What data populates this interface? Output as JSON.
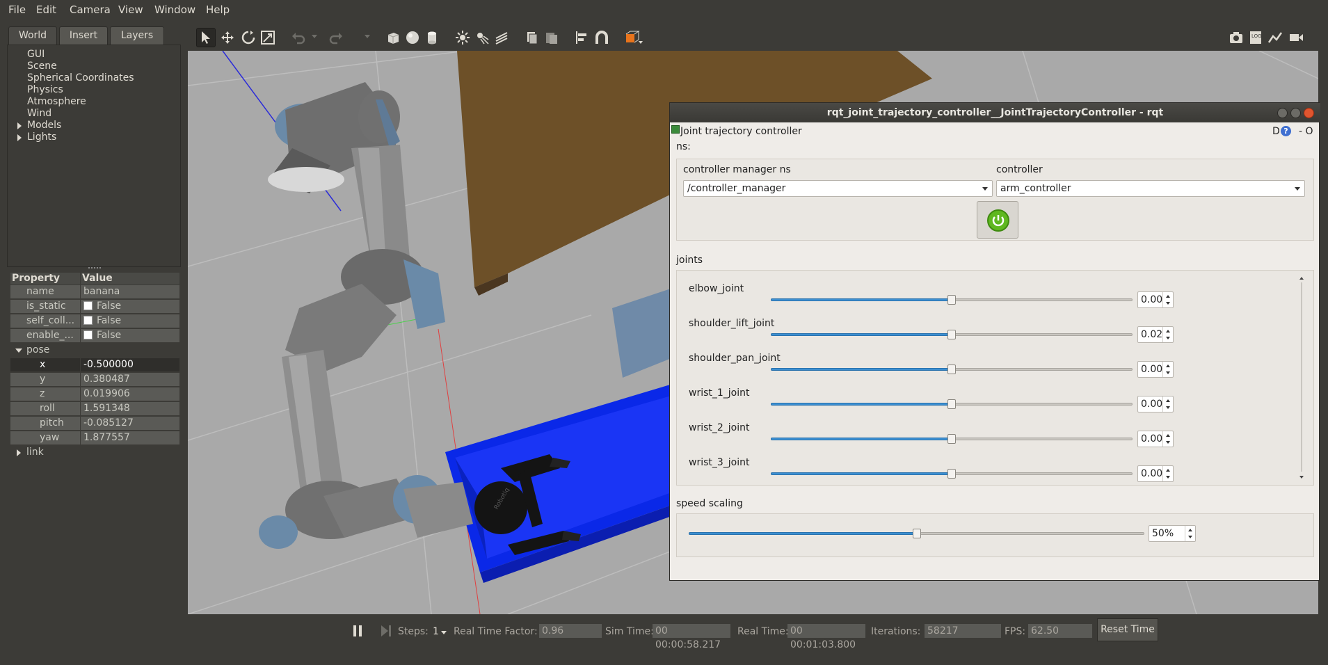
{
  "menubar": {
    "items": [
      "File",
      "Edit",
      "Camera",
      "View",
      "Window",
      "Help"
    ],
    "underline": [
      "F",
      "E",
      "C",
      "V",
      "W",
      "H"
    ]
  },
  "left_panel": {
    "tabs": [
      "World",
      "Insert",
      "Layers"
    ],
    "tree": [
      "GUI",
      "Scene",
      "Spherical Coordinates",
      "Physics",
      "Atmosphere",
      "Wind",
      "Models",
      "Lights"
    ],
    "properties": {
      "header_property": "Property",
      "header_value": "Value",
      "rows": [
        {
          "name": "name",
          "value": "banana"
        },
        {
          "name": "is_static",
          "value": "False"
        },
        {
          "name": "self_coll...",
          "value": "False"
        },
        {
          "name": "enable_...",
          "value": "False"
        },
        {
          "name": "pose",
          "value": ""
        },
        {
          "name": "x",
          "value": "-0.500000"
        },
        {
          "name": "y",
          "value": "0.380487"
        },
        {
          "name": "z",
          "value": "0.019906"
        },
        {
          "name": "roll",
          "value": "1.591348"
        },
        {
          "name": "pitch",
          "value": "-0.085127"
        },
        {
          "name": "yaw",
          "value": "1.877557"
        },
        {
          "name": "link",
          "value": ""
        }
      ]
    }
  },
  "toolbar": {
    "icons": [
      "select-arrow-icon",
      "translate-icon",
      "rotate-icon",
      "scale-icon",
      "undo-icon",
      "redo-icon",
      "box-icon",
      "sphere-icon",
      "cylinder-icon",
      "point-light-icon",
      "spot-light-icon",
      "directional-light-icon",
      "copy-icon",
      "paste-icon",
      "align-icon",
      "snap-icon",
      "change-view-icon",
      "screenshot-icon",
      "log-icon",
      "plot-icon",
      "video-icon"
    ]
  },
  "bottombar": {
    "steps_label": "Steps:",
    "steps_value": "1",
    "rtf_label": "Real Time Factor:",
    "rtf_value": "0.96",
    "sim_time_label": "Sim Time:",
    "sim_time_value": "00 00:00:58.217",
    "real_time_label": "Real Time:",
    "real_time_value": "00 00:01:03.800",
    "iterations_label": "Iterations:",
    "iterations_value": "58217",
    "fps_label": "FPS:",
    "fps_value": "62.50",
    "reset_label": "Reset Time"
  },
  "rqt": {
    "title": "rqt_joint_trajectory_controller__JointTrajectoryController - rqt",
    "plugin_title": "Joint trajectory controller",
    "plugin_controls": "D",
    "plugin_controls_right": "- O",
    "ns_label": "ns:",
    "cm_ns_label": "controller manager ns",
    "cm_ns_value": "/controller_manager",
    "controller_label": "controller",
    "controller_value": "arm_controller",
    "joints_label": "joints",
    "joints": [
      {
        "name": "elbow_joint",
        "value": "0.00",
        "level": 0.5
      },
      {
        "name": "shoulder_lift_joint",
        "value": "0.02",
        "level": 0.5
      },
      {
        "name": "shoulder_pan_joint",
        "value": "0.00",
        "level": 0.5
      },
      {
        "name": "wrist_1_joint",
        "value": "0.00",
        "level": 0.5
      },
      {
        "name": "wrist_2_joint",
        "value": "0.00",
        "level": 0.5
      },
      {
        "name": "wrist_3_joint",
        "value": "0.00",
        "level": 0.5
      }
    ],
    "speed_label": "speed scaling",
    "speed_value": "50%",
    "speed_level": 0.5,
    "accent": "#3c8fd1",
    "power_color": "#5fb820"
  }
}
